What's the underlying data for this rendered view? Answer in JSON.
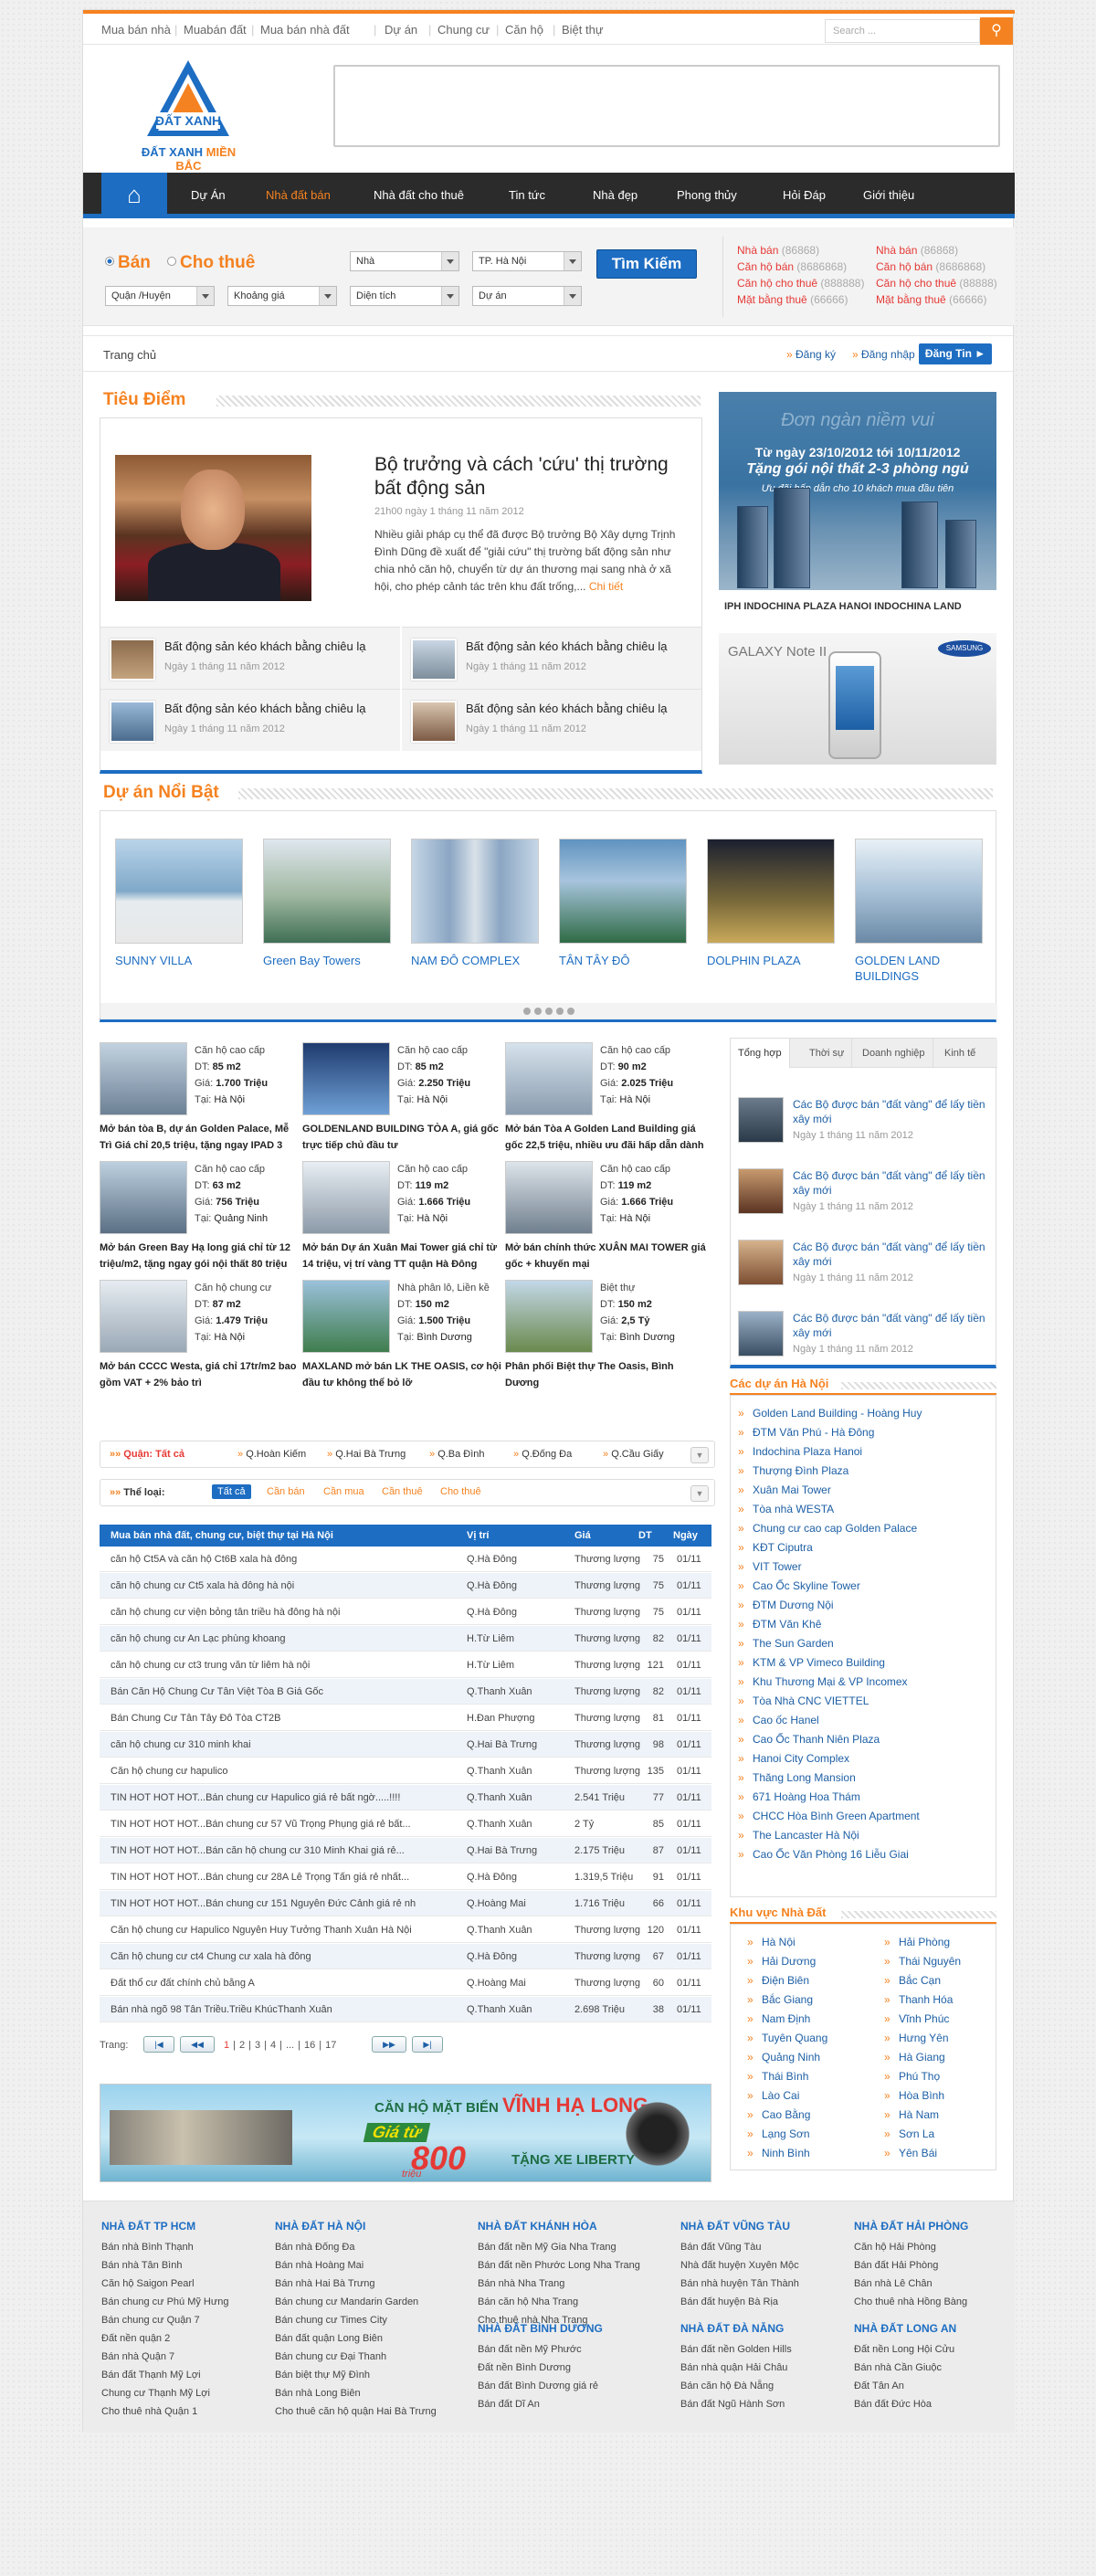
{
  "topnav": {
    "links": [
      "Mua bán nhà",
      "Muabán đất",
      "Mua bán nhà đất",
      "Dự án",
      "Chung cư",
      "Căn hộ",
      "Biệt thự"
    ],
    "search_placeholder": "Search ...",
    "search_icon": "magnifier-icon"
  },
  "logo": {
    "brand": "ĐẤT XANH",
    "region": "MIỀN BẮC"
  },
  "mainnav": {
    "items": [
      "Dự Án",
      "Nhà đất bán",
      "Nhà đất cho thuê",
      "Tin tức",
      "Nhà đẹp",
      "Phong thủy",
      "Hỏi Đáp",
      "Giới thiệu"
    ],
    "active_index": 1,
    "home_icon": "home-icon"
  },
  "search": {
    "radio_sell": "Bán",
    "radio_rent": "Cho thuê",
    "selects": [
      "Nhà",
      "TP. Hà Nội",
      "Quận /Huyện",
      "Khoảng giá",
      "Diện tích",
      "Dự án"
    ],
    "button": "Tìm Kiếm"
  },
  "stats": {
    "left": [
      {
        "label": "Nhà bán",
        "count": "(86868)"
      },
      {
        "label": "Căn hộ bán",
        "count": "(8686868)"
      },
      {
        "label": "Căn hộ cho thuê",
        "count": "(888888)"
      },
      {
        "label": "Mặt bằng thuê",
        "count": "(66666)"
      }
    ],
    "right": [
      {
        "label": "Nhà bán",
        "count": "(86868)"
      },
      {
        "label": "Căn hộ bán",
        "count": "(8686868)"
      },
      {
        "label": "Căn hộ cho thuê",
        "count": "(88888)"
      },
      {
        "label": "Mặt bằng thuê",
        "count": "(66666)"
      }
    ]
  },
  "breadcrumb": {
    "home": "Trang chủ",
    "register": "Đăng ký",
    "login": "Đăng nhập",
    "post": "Đăng Tin"
  },
  "tieudiem": {
    "heading": "Tiêu Điểm",
    "title": "Bộ trưởng và cách 'cứu' thị trường bất động sản",
    "time": "21h00 ngày 1 tháng 11 năm 2012",
    "desc": "Nhiều giải pháp cụ thể đã được Bộ trưởng Bộ Xây dựng Trịnh Đình Dũng đề xuất để \"giải cứu\" thị trường bất động sản như chia nhỏ căn hộ, chuyển từ dự án thương mại sang nhà ở xã hội, cho phép cảnh tác trên khu đất trống,...",
    "more": "Chi tiết",
    "items": [
      {
        "title": "Bất động sản kéo khách bằng chiêu lạ",
        "date": "Ngày 1 tháng 11 năm 2012"
      },
      {
        "title": "Bất động sản kéo khách bằng chiêu lạ",
        "date": "Ngày 1 tháng 11 năm 2012"
      },
      {
        "title": "Bất động sản kéo khách bằng chiêu lạ",
        "date": "Ngày 1 tháng 11 năm 2012"
      },
      {
        "title": "Bất động sản kéo khách bằng chiêu lạ",
        "date": "Ngày 1 tháng 11 năm 2012"
      }
    ]
  },
  "ad1": {
    "slogan": "Đơn ngàn niềm vui",
    "dates": "Từ ngày 23/10/2012 tới 10/11/2012",
    "offer": "Tặng gói nội thất 2-3 phòng ngủ",
    "note": "Ưu đãi hấp dẫn cho 10 khách mua đầu tiên",
    "brands": "IPH INDOCHINA PLAZA HANOI   INDOCHINA LAND"
  },
  "ad2": {
    "product": "GALAXY Note II",
    "brand": "SAMSUNG"
  },
  "duan": {
    "heading": "Dự án Nổi Bật",
    "items": [
      "SUNNY VILLA",
      "Green Bay Towers",
      "NAM ĐÔ COMPLEX",
      "TÂN TÂY ĐÔ",
      "DOLPHIN PLAZA",
      "GOLDEN LAND BUILDINGS"
    ],
    "colors": [
      "#7fa8c8",
      "#9fb7a0",
      "#8ba6c3",
      "#5f93c0",
      "#7a6a3a",
      "#a9c2d8"
    ]
  },
  "listings": [
    {
      "type": "Căn hộ cao cấp",
      "dt": "85 m2",
      "gia": "1.700 Triệu",
      "tai": "Hà Nội",
      "title": "Mở bán tòa B, dự án Golden Palace, Mễ Trì Giá chỉ 20,5 triệu, tặng ngay IPAD 3"
    },
    {
      "type": "Căn hộ cao cấp",
      "dt": "85 m2",
      "gia": "2.250 Triệu",
      "tai": "Hà Nội",
      "title": "GOLDENLAND BUILDING TÒA A, giá gốc trực tiếp chủ đầu tư"
    },
    {
      "type": "Căn hộ cao cấp",
      "dt": "90 m2",
      "gia": "2.025 Triệu",
      "tai": "Hà Nội",
      "title": "Mở bán Tòa A Golden Land Building giá gốc 22,5 triệu, nhiều ưu đãi hấp dẫn dành"
    },
    {
      "type": "Căn hộ cao cấp",
      "dt": "63 m2",
      "gia": "756 Triệu",
      "tai": "Quảng Ninh",
      "title": "Mở bán Green Bay Hạ long giá chỉ từ 12 triệu/m2, tặng ngay gói nội thất 80 triệu"
    },
    {
      "type": "Căn hộ cao cấp",
      "dt": "119 m2",
      "gia": "1.666 Triệu",
      "tai": "Hà Nội",
      "title": "Mở bán Dự án Xuân Mai Tower giá chỉ từ 14 triệu, vị trí vàng TT quận Hà Đông"
    },
    {
      "type": "Căn hộ cao cấp",
      "dt": "119 m2",
      "gia": "1.666 Triệu",
      "tai": "Hà Nội",
      "title": "Mở bán chính thức XUÂN MAI TOWER giá gốc + khuyến mại"
    },
    {
      "type": "Căn hộ chung cư",
      "dt": "87 m2",
      "gia": "1.479 Triệu",
      "tai": "Hà Nội",
      "title": "Mở bán CCCC Westa, giá chỉ 17tr/m2 bao gồm VAT + 2% bảo trì"
    },
    {
      "type": "Nhà phân lô, Liền kề",
      "dt": "150 m2",
      "gia": "1.500 Triệu",
      "tai": "Bình Dương",
      "title": "MAXLAND mở bán LK THE OASIS, cơ hội đầu tư không thể bỏ lỡ"
    },
    {
      "type": "Biệt thự",
      "dt": "150 m2",
      "gia": "2,5 Tỷ",
      "tai": "Bình Dương",
      "title": "Phân phối Biệt thự The Oasis, Bình Dương"
    }
  ],
  "listing_labels": {
    "dt": "DT:",
    "gia": "Giá:",
    "tai": "Tại:"
  },
  "tabs": {
    "labels": [
      "Tổng hợp",
      "Thời sự",
      "Doanh nghiệp",
      "Kinh tế"
    ],
    "items": [
      {
        "title": "Các Bộ được bán \"đất vàng\" để lấy tiền xây mới",
        "date": "Ngày 1 tháng 11 năm 2012"
      },
      {
        "title": "Các Bộ được bán \"đất vàng\" để lấy tiền xây mới",
        "date": "Ngày 1 tháng 11 năm 2012"
      },
      {
        "title": "Các Bộ được bán \"đất vàng\" để lấy tiền xây mới",
        "date": "Ngày 1 tháng 11 năm 2012"
      },
      {
        "title": "Các Bộ được bán \"đất vàng\" để lấy tiền xây mới",
        "date": "Ngày 1 tháng 11 năm 2012"
      }
    ]
  },
  "projects": {
    "heading": "Các dự án Hà Nội",
    "items": [
      "Golden Land Building - Hoàng Huy",
      "ĐTM Văn Phú - Hà Đông",
      "Indochina Plaza Hanoi",
      "Thượng Đình Plaza",
      "Xuân Mai Tower",
      "Tòa nhà WESTA",
      "Chung cư cao cap Golden Palace",
      "KĐT Ciputra",
      "VIT Tower",
      "Cao Ốc Skyline Tower",
      "ĐTM Dương Nội",
      "ĐTM Văn Khê",
      "The Sun Garden",
      "KTM & VP Vimeco Building",
      "Khu Thương Mại & VP Incomex",
      "Tòa Nhà CNC VIETTEL",
      "Cao ốc Hanel",
      "Cao Ốc Thanh Niên Plaza",
      "Hanoi City Complex",
      "Thăng Long Mansion",
      "671 Hoàng Hoa Thám",
      "CHCC Hòa Bình Green Apartment",
      "The Lancaster Hà Nội",
      "Cao Ốc Văn Phòng 16 Liễu Giai"
    ]
  },
  "areas": {
    "heading": "Khu vực Nhà Đất",
    "left": [
      "Hà Nội",
      "Hải Dương",
      "Điện Biên",
      "Bắc Giang",
      "Nam Định",
      "Tuyên Quang",
      "Quảng Ninh",
      "Thái Bình",
      "Lào Cai",
      "Cao Bằng",
      "Lạng Sơn",
      "Ninh Bình"
    ],
    "right": [
      "Hải Phòng",
      "Thái Nguyên",
      "Bắc Cạn",
      "Thanh Hóa",
      "Vĩnh Phúc",
      "Hưng Yên",
      "Hà Giang",
      "Phú Thọ",
      "Hòa Bình",
      "Hà Nam",
      "Sơn La",
      "Yên Bái"
    ]
  },
  "filter": {
    "district_label": "Quận:",
    "district_all": "Tất cả",
    "districts": [
      "Q.Hoàn Kiếm",
      "Q.Hai Bà Trưng",
      "Q.Ba Đình",
      "Q.Đống Đa",
      "Q.Cầu Giấy"
    ],
    "type_label": "Thể loại:",
    "types": [
      "Tất cả",
      "Cần bán",
      "Cần mua",
      "Cần thuê",
      "Cho thuê"
    ]
  },
  "table": {
    "headers": [
      "Mua bán nhà đất, chung cư, biệt thự tại Hà Nội",
      "Vị trí",
      "Giá",
      "DT",
      "Ngày"
    ],
    "rows": [
      [
        "căn hộ Ct5A và căn hộ Ct6B xala hà đông",
        "Q.Hà Đông",
        "Thương lượng",
        "75",
        "01/11"
      ],
      [
        "căn hộ chung cư Ct5 xala hà đông hà nội",
        "Q.Hà Đông",
        "Thương lượng",
        "75",
        "01/11"
      ],
      [
        "căn hộ chung cư viện bỏng tân triều hà đông hà nội",
        "Q.Hà Đông",
        "Thương lượng",
        "75",
        "01/11"
      ],
      [
        "căn hộ chung cư An Lạc phùng khoang",
        "H.Từ Liêm",
        "Thương lượng",
        "82",
        "01/11"
      ],
      [
        "căn hộ chung cư ct3 trung văn từ liêm hà nội",
        "H.Từ Liêm",
        "Thương lượng",
        "121",
        "01/11"
      ],
      [
        "Bán Căn Hộ Chung Cư Tân Việt Tòa B Giá Gốc",
        "Q.Thanh Xuân",
        "Thương lượng",
        "82",
        "01/11"
      ],
      [
        "Bán Chung Cư Tân Tây Đô Tòa CT2B",
        "H.Đan Phượng",
        "Thương lượng",
        "81",
        "01/11"
      ],
      [
        "căn hộ chung cư 310 minh khai",
        "Q.Hai Bà Trưng",
        "Thương lượng",
        "98",
        "01/11"
      ],
      [
        "Căn hộ chung cư hapulico",
        "Q.Thanh Xuân",
        "Thương lượng",
        "135",
        "01/11"
      ],
      [
        "TIN HOT HOT HOT...Bán chung cư Hapulico giá rẻ bất ngờ.....!!!!",
        "Q.Thanh Xuân",
        "2.541 Triệu",
        "77",
        "01/11"
      ],
      [
        "TIN HOT HOT HOT...Bán chung cư 57 Vũ Trọng Phụng giá rẻ bất...",
        "Q.Thanh Xuân",
        "2 Tỷ",
        "85",
        "01/11"
      ],
      [
        "TIN HOT HOT HOT...Bán căn hộ chung cư 310 Minh Khai giá rẻ...",
        "Q.Hai Bà Trưng",
        "2.175 Triệu",
        "87",
        "01/11"
      ],
      [
        "TIN HOT HOT HOT...Bán chung cư 28A Lê Trọng Tấn giá rẻ nhất...",
        "Q.Hà Đông",
        "1.319,5 Triệu",
        "91",
        "01/11"
      ],
      [
        "TIN HOT HOT HOT...Bán chung cư 151 Nguyễn Đức Cảnh giá rẻ nh",
        "Q.Hoàng Mai",
        "1.716 Triệu",
        "66",
        "01/11"
      ],
      [
        "Căn hộ chung cư Hapulico Nguyễn Huy Tưởng Thanh Xuân Hà Nội",
        "Q.Thanh Xuân",
        "Thương lượng",
        "120",
        "01/11"
      ],
      [
        "Căn hộ chung cư ct4 Chung cư xala hà đông",
        "Q.Hà Đông",
        "Thương lượng",
        "67",
        "01/11"
      ],
      [
        "Đất thổ cư đất chính chủ bằng A",
        "Q.Hoàng Mai",
        "Thương lượng",
        "60",
        "01/11"
      ],
      [
        "Bán nhà ngõ 98 Tân Triều.Triều KhúcThanh Xuân",
        "Q.Thanh Xuân",
        "2.698 Triệu",
        "38",
        "01/11"
      ]
    ]
  },
  "pager": {
    "label": "Trang:",
    "pages": [
      "1",
      "2",
      "3",
      "4",
      "...",
      "16",
      "17"
    ],
    "current": "1"
  },
  "adbot": {
    "line1": "CĂN HỘ MẶT BIỂN",
    "city": "VĨNH HẠ LONG",
    "line2": "Giá từ",
    "price": "800",
    "gift": "TẶNG XE LIBERTY",
    "unit": "triệu"
  },
  "footer": {
    "cols": [
      {
        "head": "NHÀ ĐẤT TP HCM",
        "links": [
          "Bán nhà Bình Thạnh",
          "Bán nhà Tân Bình",
          "Căn hộ Saigon Pearl",
          "Bán chung cư Phú Mỹ Hưng",
          "Bán chung cư Quận 7",
          "Đất nền quận 2",
          "Bán nhà Quận 7",
          "Bán đất Thạnh Mỹ Lợi",
          "Chung cư Thạnh Mỹ Lợi",
          "Cho thuê nhà Quận 1"
        ]
      },
      {
        "head": "NHÀ ĐẤT HÀ NỘI",
        "links": [
          "Bán nhà Đống Đa",
          "Bán nhà Hoàng Mai",
          "Bán nhà Hai Bà Trưng",
          "Bán chung cư Mandarin Garden",
          "Bán chung cư Times City",
          "Bán đất quận Long Biên",
          "Bán chung cư Đại Thanh",
          "Bán biệt thự Mỹ Đình",
          "Bán nhà Long Biên",
          "Cho thuê căn hộ quận Hai Bà Trưng"
        ]
      },
      {
        "head": "NHÀ ĐẤT KHÁNH HÒA",
        "links": [
          "Bán đất nền Mỹ Gia Nha Trang",
          "Bán đất nền Phước Long Nha Trang",
          "Bán nhà Nha Trang",
          "Bán căn hộ Nha Trang",
          "Cho thuê nhà Nha Trang"
        ]
      },
      {
        "head": "NHÀ ĐẤT BÌNH DƯƠNG",
        "links": [
          "Bán đất nền Mỹ Phước",
          "Đất nền Bình Dương",
          "Bán đất Bình Dương giá rẻ",
          "Bán đất Dĩ An"
        ]
      },
      {
        "head": "NHÀ ĐẤT VŨNG TÀU",
        "links": [
          "Bán đất Vũng Tàu",
          "Nhà đất huyện Xuyên Mộc",
          "Bán nhà huyện Tân Thành",
          "Bán đất huyện Bà Rịa"
        ]
      },
      {
        "head": "NHÀ ĐẤT ĐÀ NẴNG",
        "links": [
          "Bán đất nền Golden Hills",
          "Bán nhà quận Hải Châu",
          "Bán căn hộ Đà Nẵng",
          "Bán đất Ngũ Hành Sơn"
        ]
      },
      {
        "head": "NHÀ ĐẤT HẢI PHÒNG",
        "links": [
          "Căn hộ Hải Phòng",
          "Bán đất Hải Phòng",
          "Bán nhà Lê Chân",
          "Cho thuê nhà Hồng Bàng"
        ]
      },
      {
        "head": "NHÀ ĐẤT LONG AN",
        "links": [
          "Đất nền Long Hội Cửu",
          "Bán nhà Cần Giuộc",
          "Đất Tân An",
          "Bán đất Đức Hòa"
        ]
      }
    ]
  }
}
